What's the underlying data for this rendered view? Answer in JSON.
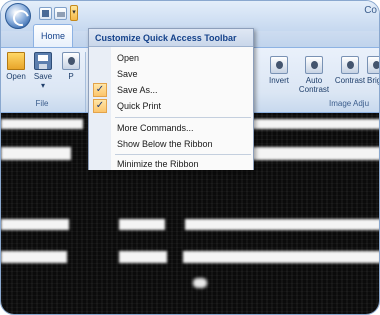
{
  "titlebar": {
    "title": "Co",
    "qat_more_glyph": "▾"
  },
  "ribbon": {
    "active_tab": "Home",
    "file_group": {
      "label": "File",
      "buttons": [
        {
          "label": "Open"
        },
        {
          "label": "Save",
          "sub": "▾"
        },
        {
          "label": "P"
        }
      ]
    },
    "adjust_group": {
      "label": "Image Adju",
      "buttons": [
        {
          "label": "Invert"
        },
        {
          "label": "Auto",
          "label2": "Contrast"
        },
        {
          "label": "Contrast"
        },
        {
          "label": "Brig"
        }
      ]
    }
  },
  "menu": {
    "title": "Customize Quick Access Toolbar",
    "items": [
      {
        "label": "Open",
        "checked": false
      },
      {
        "label": "Save",
        "checked": false
      },
      {
        "label": "Save As...",
        "checked": true
      },
      {
        "label": "Quick Print",
        "checked": true
      },
      {
        "label": "More Commands...",
        "checked": false
      },
      {
        "label": "Show Below the Ribbon",
        "checked": false
      },
      {
        "label": "Minimize the Ribbon",
        "checked": false
      }
    ],
    "check_glyph": "✓"
  }
}
